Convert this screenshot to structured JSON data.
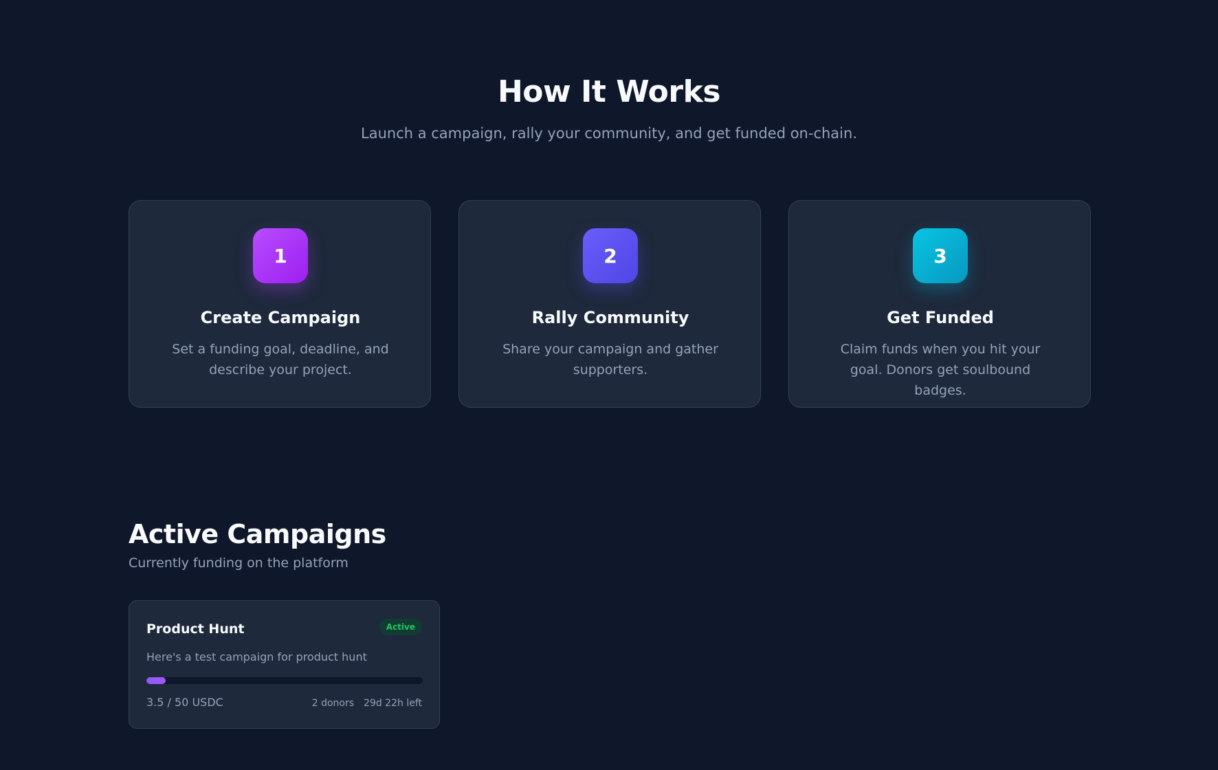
{
  "how_it_works": {
    "title": "How It Works",
    "subtitle": "Launch a campaign, rally your community, and get funded on-chain.",
    "steps": [
      {
        "number": "1",
        "title": "Create Campaign",
        "description": "Set a funding goal, deadline, and describe your project.",
        "accent": "#a93bf7"
      },
      {
        "number": "2",
        "title": "Rally Community",
        "description": "Share your campaign and gather supporters.",
        "accent": "#5b52f1"
      },
      {
        "number": "3",
        "title": "Get Funded",
        "description": "Claim funds when you hit your goal. Donors get soulbound badges.",
        "accent": "#08b0d2"
      }
    ]
  },
  "active_campaigns": {
    "title": "Active Campaigns",
    "subtitle": "Currently funding on the platform",
    "campaigns": [
      {
        "title": "Product Hunt",
        "status": "Active",
        "description": "Here's a test campaign for product hunt",
        "raised_label": "3.5 / 50 USDC",
        "progress_fraction": 0.07,
        "donors_label": "2 donors",
        "time_left_label": "29d 22h left"
      }
    ]
  },
  "colors": {
    "background": "#0f172a",
    "card": "#1e293b",
    "status_active": "#22c55e",
    "progress_fill": "#8b5cf6"
  }
}
